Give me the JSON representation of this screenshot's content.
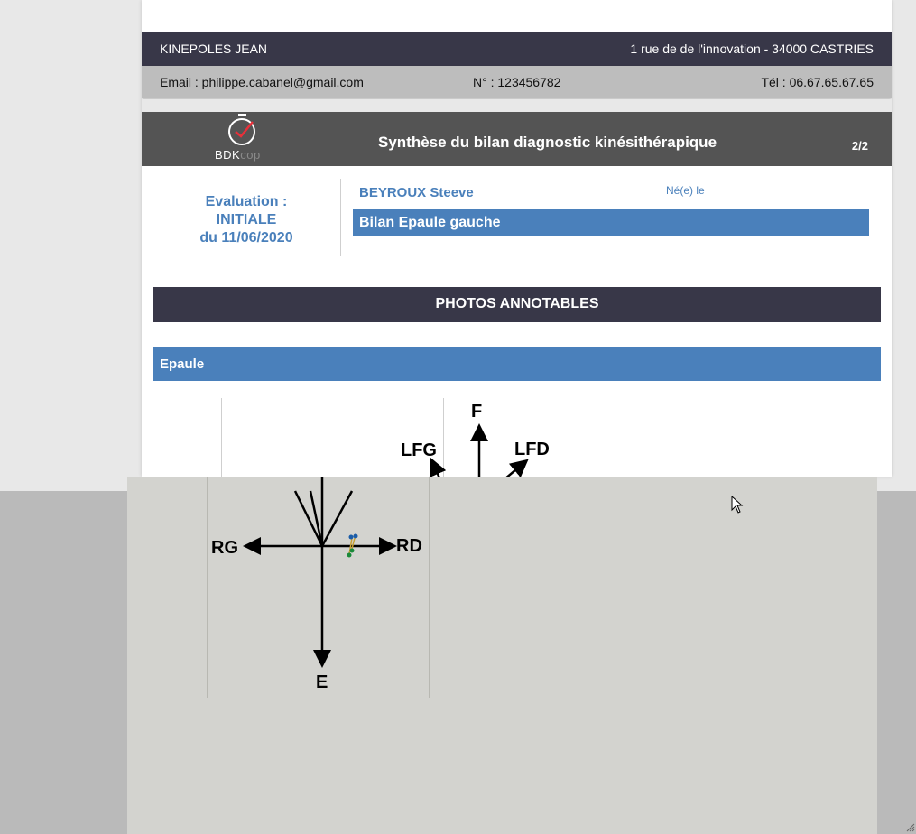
{
  "company": {
    "name": "KINEPOLES JEAN",
    "address": "1 rue de de l'innovation  - 34000 CASTRIES",
    "email": "Email : philippe.cabanel@gmail.com",
    "number": "N° : 123456782",
    "phone": "Tél : 06.67.65.67.65"
  },
  "header": {
    "logo_main": "BDK",
    "logo_sub": "cop",
    "title": "Synthèse du bilan diagnostic kinésithérapique",
    "page": "2/2"
  },
  "evaluation": {
    "label": "Evaluation :",
    "type": "INITIALE",
    "date": "du 11/06/2020"
  },
  "patient": {
    "name": "BEYROUX Steeve",
    "born_label": "Né(e) le",
    "bilan": "Bilan Epaule gauche"
  },
  "sections": {
    "photos_title": "PHOTOS ANNOTABLES",
    "body_part": "Epaule"
  },
  "diagram": {
    "labels": {
      "front": "F",
      "left_front": "LFG",
      "right_front": "LFD",
      "left": "RG",
      "right": "RD",
      "back": "E"
    }
  },
  "icons": {
    "logo": "stopwatch-icon",
    "cursor": "mouse-cursor-icon",
    "resize": "resize-grip-icon"
  },
  "colors": {
    "dark_bar": "#383748",
    "grey_bar": "#bdbdbd",
    "title_bar": "#545454",
    "accent_blue": "#4a80bb"
  }
}
